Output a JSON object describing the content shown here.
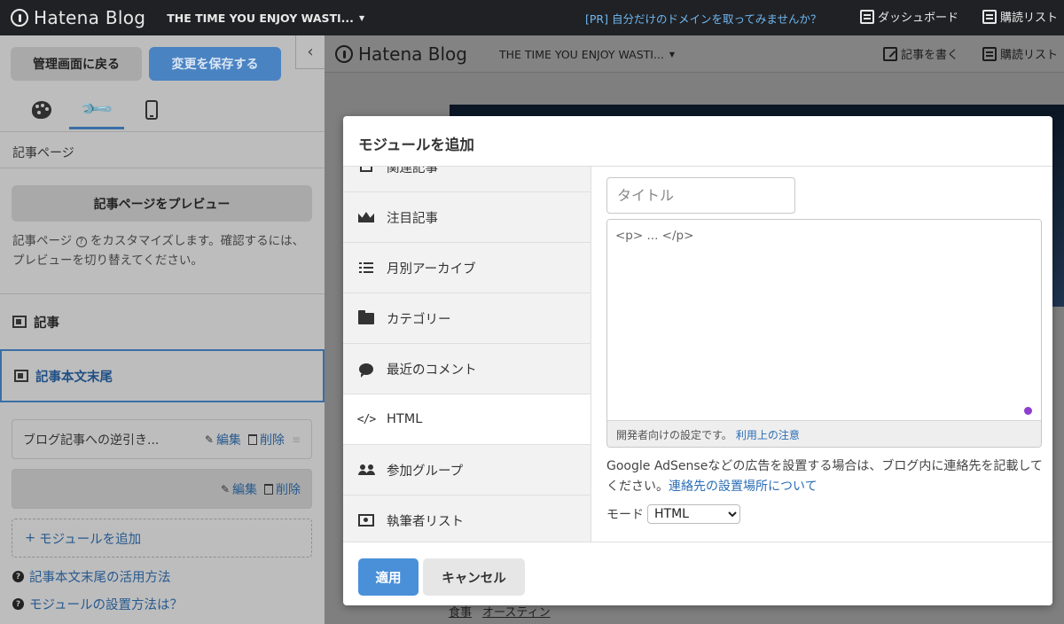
{
  "topbar": {
    "logo": "Hatena Blog",
    "blog_name": "THE TIME YOU ENJOY WASTI...",
    "promo": "[PR] 自分だけのドメインを取ってみませんか？",
    "dashboard": "ダッシュボード",
    "subscriptions": "購読リスト"
  },
  "sidebar": {
    "back_button": "管理画面に戻る",
    "save_button": "変更を保存する",
    "section_label": "記事ページ",
    "preview_button": "記事ページをプレビュー",
    "description_1": "記事ページ",
    "description_2": "をカスタマイズします。確認するには、プレビューを切り替えてください。",
    "nav_items": [
      "記事",
      "記事本文末尾"
    ],
    "module_row_title": "ブログ記事への逆引き...",
    "edit_label": "編集",
    "delete_label": "削除",
    "add_module": "モジュールを追加",
    "help_links": [
      "記事本文末尾の活用方法",
      "モジュールの設置方法は？"
    ]
  },
  "preview": {
    "logo": "Hatena Blog",
    "blog_name": "THE TIME YOU ENJOY WASTI...",
    "write": "記事を書く",
    "subscriptions": "購読リスト",
    "footer_links": [
      "食事",
      "オースティン"
    ]
  },
  "modal": {
    "title": "モジュールを追加",
    "list_items": [
      "関連記事",
      "注目記事",
      "月別アーカイブ",
      "カテゴリー",
      "最近のコメント",
      "HTML",
      "参加グループ",
      "執筆者リスト"
    ],
    "active_item": "HTML",
    "title_placeholder": "タイトル",
    "html_placeholder": "<p> ... </p>",
    "dev_note": "開発者向けの設定です。",
    "dev_note_link": "利用上の注意",
    "adsense_text": "Google AdSenseなどの広告を設置する場合は、ブログ内に連絡先を記載してください。",
    "adsense_link": "連絡先の設置場所について",
    "mode_label": "モード",
    "mode_value": "HTML",
    "apply_button": "適用",
    "cancel_button": "キャンセル"
  },
  "colors": {
    "accent": "#4a90d9",
    "link": "#2a6db5",
    "topbar": "#202124",
    "overlay_sidebar": "#bdbdbd"
  }
}
